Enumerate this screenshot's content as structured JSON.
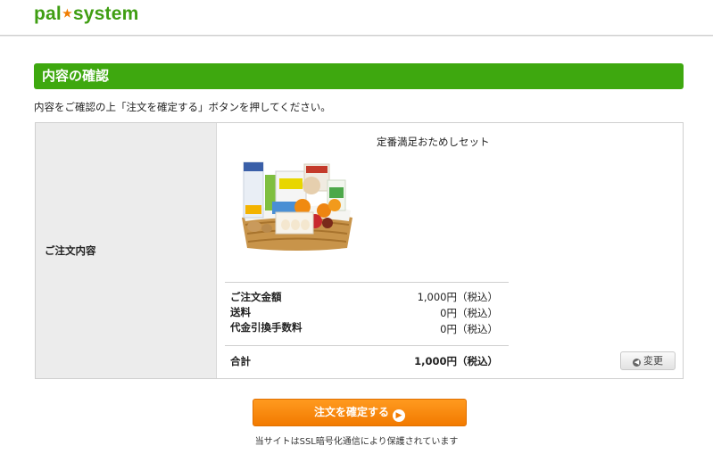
{
  "header": {
    "logo_left": "pal",
    "logo_right": "system"
  },
  "section": {
    "title": "内容の確認"
  },
  "instruction": "内容をご確認の上「注文を確定する」ボタンを押してください。",
  "order": {
    "label": "ご注文内容",
    "product_name": "定番満足おためしセット",
    "rows": [
      {
        "label": "ご注文金額",
        "value": "1,000円（税込）"
      },
      {
        "label": "送料",
        "value": "0円（税込）"
      },
      {
        "label": "代金引換手数料",
        "value": "0円（税込）"
      }
    ],
    "total": {
      "label": "合計",
      "value": "1,000円（税込）"
    },
    "change_label": "変更"
  },
  "confirm": {
    "label": "注文を確定する"
  },
  "ssl_note": "当サイトはSSL暗号化通信により保護されています"
}
